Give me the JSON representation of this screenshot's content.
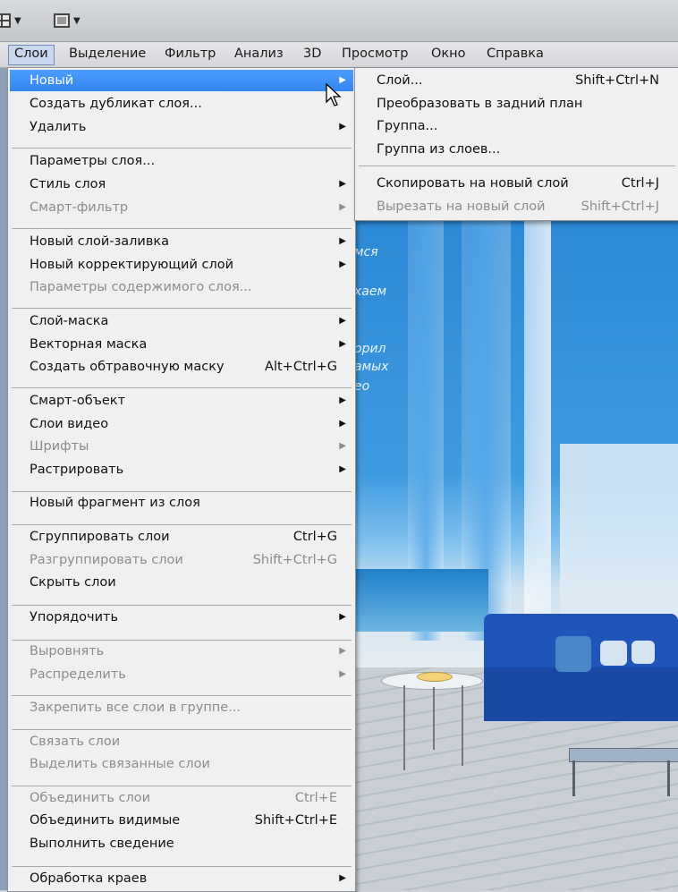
{
  "menubar": {
    "items": [
      "Слои",
      "Выделение",
      "Фильтр",
      "Анализ",
      "3D",
      "Просмотр",
      "Окно",
      "Справка"
    ]
  },
  "layer_menu": {
    "items": [
      {
        "label": "Новый",
        "submenu": true,
        "highlighted": true
      },
      {
        "label": "Создать дубликат слоя..."
      },
      {
        "label": "Удалить",
        "submenu": true
      },
      {
        "label": "Параметры слоя..."
      },
      {
        "label": "Стиль слоя",
        "submenu": true
      },
      {
        "label": "Смарт-фильтр",
        "submenu": true,
        "disabled": true
      },
      {
        "label": "Новый слой-заливка",
        "submenu": true
      },
      {
        "label": "Новый корректирующий слой",
        "submenu": true
      },
      {
        "label": "Параметры содержимого слоя...",
        "disabled": true
      },
      {
        "label": "Слой-маска",
        "submenu": true
      },
      {
        "label": "Векторная маска",
        "submenu": true
      },
      {
        "label": "Создать обтравочную маску",
        "shortcut": "Alt+Ctrl+G"
      },
      {
        "label": "Смарт-объект",
        "submenu": true
      },
      {
        "label": "Слои видео",
        "submenu": true
      },
      {
        "label": "Шрифты",
        "submenu": true,
        "disabled": true
      },
      {
        "label": "Растрировать",
        "submenu": true
      },
      {
        "label": "Новый фрагмент из слоя"
      },
      {
        "label": "Сгруппировать слои",
        "shortcut": "Ctrl+G"
      },
      {
        "label": "Разгруппировать слои",
        "shortcut": "Shift+Ctrl+G",
        "disabled": true
      },
      {
        "label": "Скрыть слои"
      },
      {
        "label": "Упорядочить",
        "submenu": true
      },
      {
        "label": "Выровнять",
        "submenu": true,
        "disabled": true
      },
      {
        "label": "Распределить",
        "submenu": true,
        "disabled": true
      },
      {
        "label": "Закрепить все слои в группе...",
        "disabled": true
      },
      {
        "label": "Связать слои",
        "disabled": true
      },
      {
        "label": "Выделить связанные слои",
        "disabled": true
      },
      {
        "label": "Объединить слои",
        "shortcut": "Ctrl+E",
        "disabled": true
      },
      {
        "label": "Объединить видимые",
        "shortcut": "Shift+Ctrl+E"
      },
      {
        "label": "Выполнить сведение"
      },
      {
        "label": "Обработка краев",
        "submenu": true
      }
    ]
  },
  "new_submenu": {
    "items": [
      {
        "label": "Слой...",
        "shortcut": "Shift+Ctrl+N"
      },
      {
        "label": "Преобразовать в задний план"
      },
      {
        "label": "Группа..."
      },
      {
        "label": "Группа из слоев..."
      },
      {
        "label": "Скопировать на новый слой",
        "shortcut": "Ctrl+J"
      },
      {
        "label": "Вырезать на новый слой",
        "shortcut": "Shift+Ctrl+J",
        "disabled": true
      }
    ]
  },
  "background_text": [
    "мся",
    "хаем",
    "орил",
    "амых",
    "ео"
  ],
  "colors": {
    "highlight": "#3a8df5",
    "menu_bg": "#f0f0f0",
    "disabled_text": "#8c8c8c"
  }
}
